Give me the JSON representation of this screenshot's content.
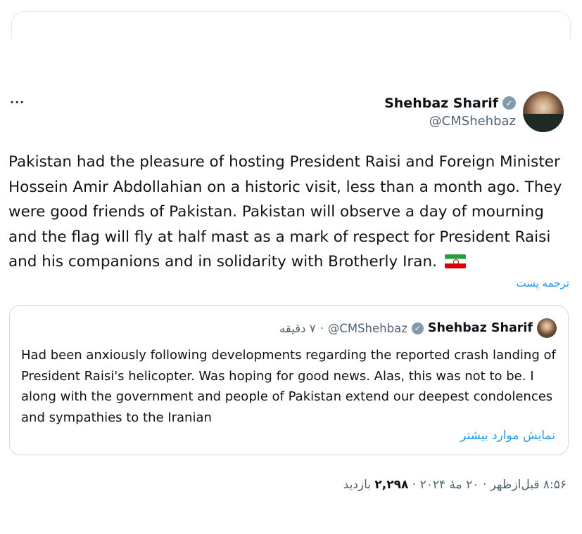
{
  "author": {
    "display_name": "Shehbaz Sharif",
    "handle": "@CMShehbaz",
    "verified_icon": "verified-badge-gray"
  },
  "more_icon": "···",
  "tweet": {
    "text": "Pakistan had the pleasure of hosting President Raisi and Foreign Minister Hossein Amir Abdollahian on a historic visit, less than a month ago. They were good friends of Pakistan. Pakistan will observe a day of mourning and the flag will fly at half mast as a mark of respect for President Raisi and his companions and in solidarity with Brotherly Iran.",
    "flag_icon": "iran-flag-icon",
    "translate_label": "ترجمه پست"
  },
  "quote": {
    "display_name": "Shehbaz Sharif",
    "handle": "@CMShehbaz",
    "separator": "·",
    "time": "۷ دقیقه",
    "text": "Had been anxiously following developments regarding the reported crash landing of President Raisi's helicopter. Was hoping for good news. Alas, this was not to be. I along with the government and people of Pakistan extend our deepest condolences and sympathies to the Iranian",
    "show_more": "نمایش موارد بیشتر"
  },
  "meta": {
    "time": "۸:۵۶ قبل‌ازظهر",
    "sep1": " · ",
    "date": "۲۰ مهٔ ۲۰۲۴",
    "sep2": " · ",
    "views_count": "۲,۲۹۸",
    "views_label": " بازدید"
  },
  "colors": {
    "link": "#1d9bf0",
    "secondary_text": "#536471",
    "verified_badge": "#829aab"
  }
}
